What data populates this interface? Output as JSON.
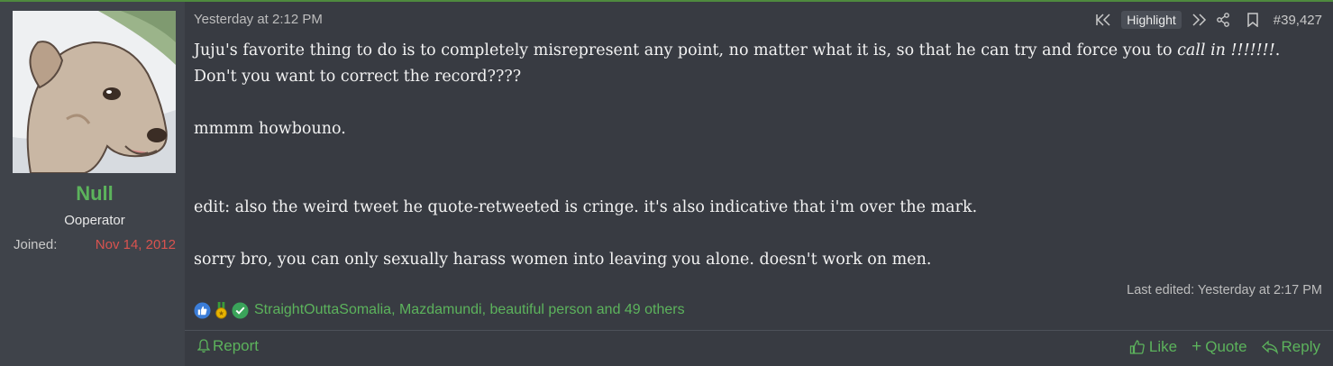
{
  "user": {
    "name": "Null",
    "title": "Ooperator",
    "joined_label": "Joined:",
    "joined_value": "Nov 14, 2012"
  },
  "post": {
    "date": "Yesterday at 2:12 PM",
    "highlight_label": "Highlight",
    "post_number": "#39,427",
    "paragraphs": {
      "p1_text": "Juju's favorite thing to do is to completely misrepresent any point, no matter what it is, so that he can try and force you to ",
      "p1_italic": "call in !!!!!!!",
      "p1_end": ".",
      "p2": "Don't you want to correct the record????",
      "p3": "mmmm howbouno.",
      "p4": "edit: also the weird tweet he quote-retweeted is cringe. it's also indicative that i'm over the mark.",
      "p5": "sorry bro, you can only sexually harass women into leaving you alone. doesn't work on men."
    },
    "last_edited": "Last edited: Yesterday at 2:17 PM"
  },
  "reactions": {
    "users_text": "StraightOuttaSomalia, Mazdamundi, beautiful person and 49 others",
    "icons": [
      "like-reaction-icon",
      "medal-reaction-icon",
      "check-reaction-icon"
    ]
  },
  "footer": {
    "report_label": "Report",
    "like_label": "Like",
    "quote_label": "Quote",
    "reply_label": "Reply"
  },
  "colors": {
    "accent_green": "#5cb35c",
    "joined_red": "#d9534f",
    "background": "#383b42",
    "user_cell": "#3f434a"
  }
}
